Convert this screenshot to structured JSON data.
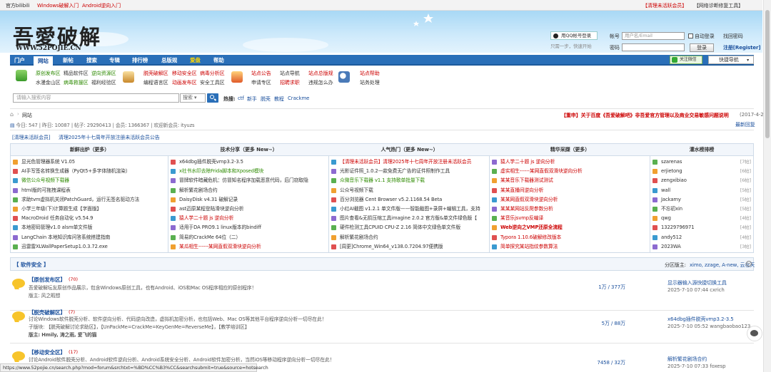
{
  "topbar": {
    "left": "官方bilibili",
    "link1": "Windows破解入门",
    "link2": "Android逆向入门",
    "right1": "【清理未活跃会员】",
    "right2": "【网络诊断修复工具】"
  },
  "logo": {
    "text": "吾愛破解",
    "url": "WWW.52POJIE.CN"
  },
  "login": {
    "qq_btn": "用QQ帐号登录",
    "qq_tip": "只需一步，快速开始",
    "account_label": "帐号",
    "account_placeholder": "用户名/Email",
    "auto_login": "自动登录",
    "find_pwd": "找回密码",
    "pwd_label": "密码",
    "login_btn": "登录",
    "register": "注册[Register]"
  },
  "nav": {
    "items": [
      "门户",
      "网站",
      "新帖",
      "搜索",
      "专辑",
      "排行榜",
      "总版规",
      "爱盘",
      "帮助"
    ],
    "wechat": "关注微信",
    "quick": "快捷导航"
  },
  "subnav": {
    "g1a": [
      "原创发布区",
      "精品软件区",
      "逆向资源区"
    ],
    "g1b": [
      "水漫金山区",
      "病毒救援区",
      "福利经验区"
    ],
    "g2a": [
      "脱壳破解区",
      "移动安全区",
      "病毒分析区"
    ],
    "g2b": [
      "编程语言区",
      "动画发布区",
      "安全工具区"
    ],
    "g3a": [
      "站点公告",
      "站点导航",
      "站点总版规"
    ],
    "g3b": [
      "申请专区",
      "招聘求职",
      "违规怎么办"
    ],
    "g4a": "站点帮助",
    "g4b": "站务处理"
  },
  "search": {
    "placeholder": "请输入搜索内容",
    "select": "搜索",
    "hot_label": "热搜:",
    "hot": [
      "ctf",
      "新手",
      "脱壳",
      "教程",
      "Crackme"
    ]
  },
  "breadcrumb": {
    "home": "网站"
  },
  "stats": {
    "text": "今日: 547 | 昨日: 10087 | 帖子: 29290413 | 会员: 1366367 | 欢迎新会员: ityuzs",
    "notice": "【重申】关于百度《吾爱破解吧》非吾爱官方管理以及商业交易敏感问题说明",
    "notice_date": "(2017-4-25)",
    "latest": "最新回复"
  },
  "announce": {
    "tag": "[清理未活跃会员]",
    "text": "清理2025年十七周年开放注册未活跃会员公告"
  },
  "grid": {
    "headers": [
      "新鲜出炉（更多）",
      "技术分享（更多 New~）",
      "人气热门（更多 New~）",
      "精华采撷（更多）",
      "灌水榜排榜"
    ],
    "col1": [
      "显光色管理器系统 V1.05",
      "AI手写签名转换生成器（PyQt5+多字体随机渲染）",
      "微信公众号视频下载器",
      "html版的可拖拽课程表",
      "求助tvm虚拟机关闭PatchGuard，运行无签名驱动方法",
      "小学三年级(下)计算题生成【字面版】",
      "MacroDroid 任务自动化 v5.54.9",
      "本地密码管理v1.0 alsm单文件版",
      "LangChain 本地知识库问答系统搭建指南",
      "迅雷雷XLWallPaperSetup1.0.3.72.exe"
    ],
    "col2": [
      "x64dbg插件脱壳vmp3.2-3.5",
      "x社书水印去除Frida脚本和Xposed模块",
      "冒牌软件暗藏危机：仿冒知名程序加载恶意代码，后门窃取隐",
      "解析繁花剧场合约",
      "DaisyDisk v4.31 破解记录",
      "ast迈原某程登陆滑块逆向分析",
      "猿人学二十题 js 逆向分析",
      "适用于DA PRO9.1 linux版本的bindiff",
      "简易的CrackMe 64位（二）",
      "某瓜相生------某网直假双滑块逆向分析"
    ],
    "col3": [
      "【清理未活跃会员】清理2025年十七周年开放注册未活跃会员",
      "光影证件照_1.0.2—款免费无广告的证件照制作工具",
      "众微音乐下载器 v1.1 支持歌单批量下载",
      "公众号视频下载",
      "百分浏览器 Cent Browser v5.2.1168.54 Beta",
      "小红AI截图 v1.2.1 单文件版——智能截图+录屏+编辑工具，支持",
      "图片查看&无损压缩工具imagine 2.0.2 官方版&单文件绿色版【",
      "硬件检测工具CPUID CPU-Z 2.16 简体中文绿色单文件版",
      "解析繁花剧场合约",
      "[周更]Chrome_Win64_v138.0.7204.97便携版"
    ],
    "col4": [
      "猿人学二十题 js 逆向分析",
      "虚实相生------某网直假双滑块逆向分析",
      "某某音乐下载器测试测试",
      "某某直播间逆向分析",
      "某某网直假双滑块逆向分析",
      "某某某网站反爬参数分析",
      "某音乐jsvmp反编译",
      "Web逆向之VMP还原全流程",
      "Typora 1.10.6破解修改版本",
      "简单探究某站指纹参数算法"
    ],
    "col5": [
      [
        "szarenas",
        "[7帖]"
      ],
      [
        "erjietong",
        "[6帖]"
      ],
      [
        "zengxibiao",
        "[6帖]"
      ],
      [
        "wall",
        "[5帖]"
      ],
      [
        "Jackamy",
        "[5帖]"
      ],
      [
        "不忘初xin",
        "[5帖]"
      ],
      [
        "qwg",
        "[4帖]"
      ],
      [
        "13229796971",
        "[4帖]"
      ],
      [
        "andy512",
        "[4帖]"
      ],
      [
        "2023WA",
        "[3帖]"
      ]
    ]
  },
  "section": {
    "title": "软件安全",
    "mods_label": "分区版主:",
    "mods": "ximo, zzage, A-new, 云在天"
  },
  "forums": [
    {
      "name": "【原创发布区】",
      "count": "(70)",
      "desc": "吾爱破解坛友原创作品展示，包含Windows原创工具，也有Android、iOS和Mac OS程序相应的原创程序！",
      "sub": "版主: 风之暇想",
      "stats": "1万 / 377万",
      "last_title": "显示器输入源快捷切换工具",
      "last_time": "2025-7-10 07:44 cxrich"
    },
    {
      "name": "【脱壳破解区】",
      "count": "(7)",
      "desc": "讨论Windows软件脱壳分析、软件逆向分析、代码逆向改造，虚拟机加密分析，也包括Web、Mac OS等其他平台程序逆向分析一切尽在此！",
      "sub": "子版块: 【脱壳破解讨论求助区】，【UnPackMe=CrackMe=KeyGenMe=ReverseMe】，【教学培训区】",
      "sub2": "版主: Hmily, 涛之雨, 爱飞的猫",
      "stats": "5万 / 88万",
      "last_title": "x64dbg插件脱壳vmp3.2-3.5",
      "last_time": "2025-7-10 05:52 wangbaobao123"
    },
    {
      "name": "【移动安全区】",
      "count": "(17)",
      "desc": "讨论Android软件脱壳分析、Android软件逆向分析、Android系统安全分析、Android软件加密分析，当然iOS等移动程序逆向分析一切尽在此！",
      "stats": "7458 / 32万",
      "last_title": "解析繁花剧场合约",
      "last_time": "2025-7-10 07:33 foxesp"
    }
  ],
  "status_url": "https://www.52pojie.cn/search.php?mod=forum&srchtxt=%BD%CC%B3%CC&searchsubmit=true&source=hotsearch"
}
